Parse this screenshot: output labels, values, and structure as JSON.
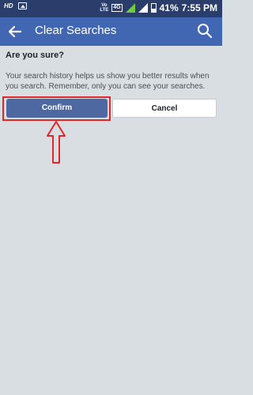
{
  "status_bar": {
    "left_label": "HD",
    "volte_label": "Vo\nLTE",
    "network_label": "4G",
    "sim_label": "1",
    "sim2_label": "2",
    "battery": "41%",
    "time": "7:55 PM"
  },
  "app_bar": {
    "title": "Clear Searches",
    "back_icon": "arrow-back-icon",
    "search_icon": "search-icon",
    "color": "#4267b2"
  },
  "dialog": {
    "heading": "Are you sure?",
    "description": "Your search history helps us show you better results when you search. Remember, only you can see your searches.",
    "confirm_label": "Confirm",
    "cancel_label": "Cancel"
  },
  "annotation": {
    "highlight_color": "#e0262b"
  }
}
